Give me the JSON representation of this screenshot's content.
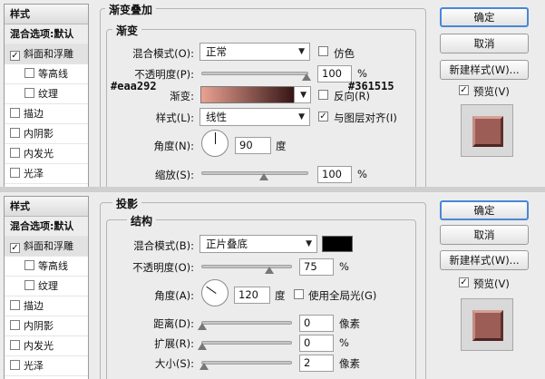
{
  "colors": {
    "grad_start": "#eaa292",
    "grad_end": "#361515",
    "shadow_color": "#000000",
    "accent": "#4a87d6"
  },
  "panel1": {
    "side": {
      "title": "样式",
      "blend": "混合选项:默认",
      "items": [
        {
          "label": "斜面和浮雕",
          "checked": true
        },
        {
          "label": "等高线",
          "checked": false
        },
        {
          "label": "纹理",
          "checked": false
        },
        {
          "label": "描边",
          "checked": false
        },
        {
          "label": "内阴影",
          "checked": false
        },
        {
          "label": "内发光",
          "checked": false
        },
        {
          "label": "光泽",
          "checked": false
        }
      ]
    },
    "section_title": "渐变叠加",
    "group_title": "渐变",
    "blend_mode_label": "混合模式(O):",
    "blend_mode_value": "正常",
    "dither_label": "仿色",
    "opacity_label": "不透明度(P):",
    "opacity_value": "100",
    "opacity_unit": "%",
    "gradient_label": "渐变:",
    "reverse_label": "反向(R)",
    "hex_left": "#eaa292",
    "hex_right": "#361515",
    "style_label": "样式(L):",
    "style_value": "线性",
    "align_label": "与图层对齐(I)",
    "angle_label": "角度(N):",
    "angle_value": "90",
    "angle_unit": "度",
    "scale_label": "缩放(S):",
    "scale_value": "100",
    "scale_unit": "%",
    "opacity_level": 1.0,
    "scale_level": 0.5,
    "buttons": {
      "ok": "确定",
      "cancel": "取消",
      "new_style": "新建样式(W)...",
      "preview": "预览(V)"
    }
  },
  "panel2": {
    "side": {
      "title": "样式",
      "blend": "混合选项:默认",
      "items": [
        {
          "label": "斜面和浮雕",
          "checked": true
        },
        {
          "label": "等高线",
          "checked": false
        },
        {
          "label": "纹理",
          "checked": false
        },
        {
          "label": "描边",
          "checked": false
        },
        {
          "label": "内阴影",
          "checked": false
        },
        {
          "label": "内发光",
          "checked": false
        },
        {
          "label": "光泽",
          "checked": false
        }
      ]
    },
    "section_title": "投影",
    "group_title": "结构",
    "blend_mode_label": "混合模式(B):",
    "blend_mode_value": "正片叠底",
    "opacity_label": "不透明度(O):",
    "opacity_value": "75",
    "opacity_unit": "%",
    "angle_label": "角度(A):",
    "angle_value": "120",
    "angle_unit": "度",
    "global_light_label": "使用全局光(G)",
    "distance_label": "距离(D):",
    "distance_value": "0",
    "distance_unit": "像素",
    "spread_label": "扩展(R):",
    "spread_value": "0",
    "spread_unit": "%",
    "size_label": "大小(S):",
    "size_value": "2",
    "size_unit": "像素",
    "opacity_level": 0.75,
    "buttons": {
      "ok": "确定",
      "cancel": "取消",
      "new_style": "新建样式(W)...",
      "preview": "预览(V)"
    }
  }
}
